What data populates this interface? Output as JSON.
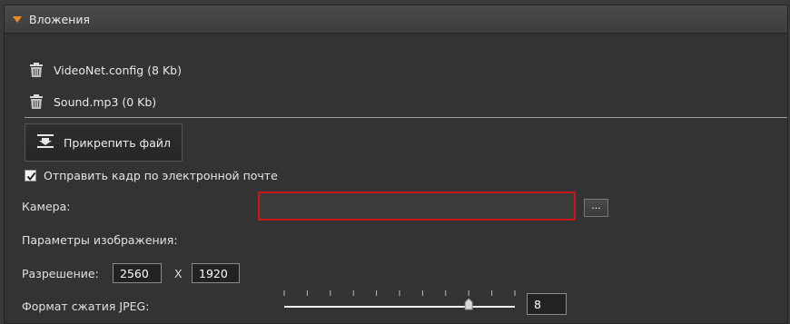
{
  "section": {
    "title": "Вложения"
  },
  "attachments": [
    {
      "name": "VideoNet.config (8 Kb)"
    },
    {
      "name": "Sound.mp3 (0 Kb)"
    }
  ],
  "attach_button": {
    "label": "Прикрепить файл"
  },
  "send_frame": {
    "label": "Отправить кадр по электронной почте",
    "checked": true
  },
  "camera": {
    "label": "Камера:",
    "value": "",
    "browse_label": "..."
  },
  "image_params": {
    "label": "Параметры изображения:"
  },
  "resolution": {
    "label": "Разрешение:",
    "width": "2560",
    "separator": "X",
    "height": "1920"
  },
  "jpeg": {
    "label": "Формат сжатия JPEG:",
    "value": "8",
    "min": 0,
    "max": 10
  },
  "colors": {
    "accent": "#f18b1c",
    "error_border": "#c8161d"
  }
}
